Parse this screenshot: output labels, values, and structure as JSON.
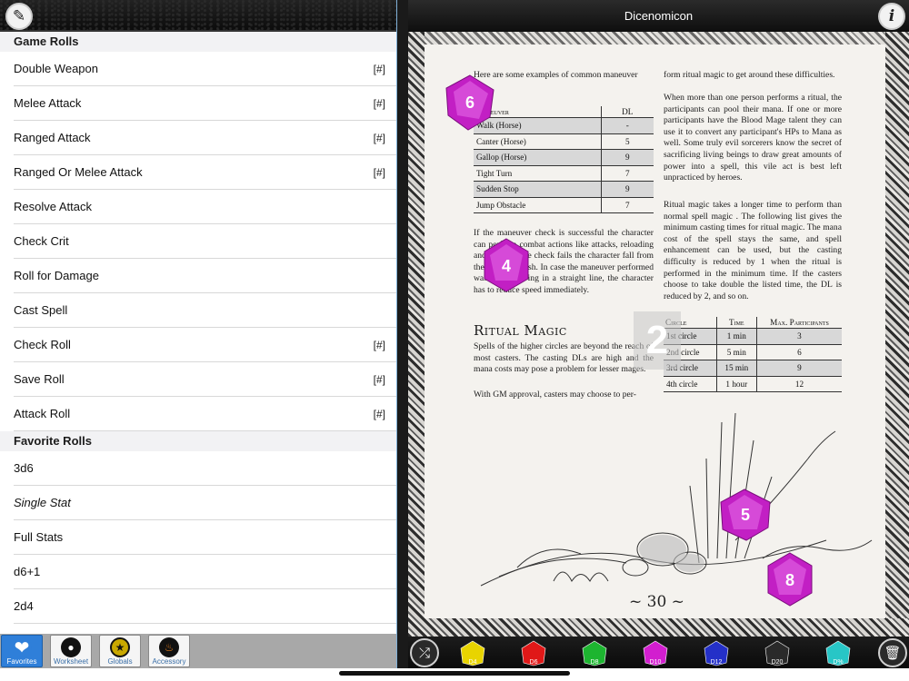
{
  "left": {
    "sections": [
      {
        "title": "Game Rolls",
        "rows": [
          {
            "label": "Double Weapon",
            "tag": "[#]"
          },
          {
            "label": "Melee Attack",
            "tag": "[#]"
          },
          {
            "label": "Ranged Attack",
            "tag": "[#]"
          },
          {
            "label": "Ranged Or Melee Attack",
            "tag": "[#]"
          },
          {
            "label": "Resolve Attack",
            "tag": ""
          },
          {
            "label": "Check Crit",
            "tag": ""
          },
          {
            "label": "Roll for Damage",
            "tag": ""
          },
          {
            "label": "Cast Spell",
            "tag": ""
          },
          {
            "label": "Check Roll",
            "tag": "[#]"
          },
          {
            "label": "Save Roll",
            "tag": "[#]"
          },
          {
            "label": "Attack Roll",
            "tag": "[#]"
          }
        ]
      },
      {
        "title": "Favorite Rolls",
        "rows": [
          {
            "label": "3d6",
            "tag": ""
          },
          {
            "label": "Single Stat",
            "tag": ""
          },
          {
            "label": "Full Stats",
            "tag": ""
          },
          {
            "label": "d6+1",
            "tag": ""
          },
          {
            "label": "2d4",
            "tag": ""
          }
        ]
      }
    ],
    "tabs": [
      {
        "label": "Favorites",
        "icon": "heart-icon"
      },
      {
        "label": "Worksheet",
        "icon": "person-icon"
      },
      {
        "label": "Globals",
        "icon": "star-icon"
      },
      {
        "label": "Accessory",
        "icon": "cauldron-icon"
      }
    ]
  },
  "right": {
    "title": "Dicenomicon",
    "page": {
      "intro": "Here are some examples of common maneuver",
      "maneuver_table": {
        "headers": [
          "Maneuver",
          "DL"
        ],
        "rows": [
          [
            "Walk (Horse)",
            "-"
          ],
          [
            "Canter (Horse)",
            "5"
          ],
          [
            "Gallop (Horse)",
            "9"
          ],
          [
            "Tight Turn",
            "7"
          ],
          [
            "Sudden Stop",
            "9"
          ],
          [
            "Jump Obstacle",
            "7"
          ]
        ]
      },
      "para1": "If the maneuver check is successful the character can perform combat actions like attacks, reloading and so on. If the check fails the character fall from the horse or crash. In case the maneuver performed was riding/driving in a straight line, the character has to reduce speed immediately.",
      "heading": "Ritual Magic",
      "para2": "Spells of the higher circles are beyond the reach of most casters. The casting DLs are high and the mana costs may pose a problem for lesser mages.",
      "para3": "With GM approval, casters may choose to per-",
      "right_para0": "form ritual magic to get around these difficulties.",
      "right_para1": "When more than one person performs a ritual, the participants can pool their mana. If one or more participants have the Blood Mage talent they can use it to convert any participant's HPs to Mana as well. Some truly evil sorcerers know the secret of sacrificing living beings to draw great amounts of power into a spell, this vile act is best left unpracticed by heroes.",
      "right_para2": "Ritual magic takes a longer time to perform than normal spell magic . The following list gives the minimum casting times for ritual magic. The mana cost of the spell stays the same, and spell enhancement can be used, but the casting difficulty is reduced by 1 when the ritual is performed in the minimum time. If the casters choose to take double the listed time, the DL is reduced by 2, and so on.",
      "circle_table": {
        "headers": [
          "Circle",
          "Time",
          "Max. Participants"
        ],
        "rows": [
          [
            "1st circle",
            "1 min",
            "3"
          ],
          [
            "2nd circle",
            "5 min",
            "6"
          ],
          [
            "3rd circle",
            "15 min",
            "9"
          ],
          [
            "4th circle",
            "1 hour",
            "12"
          ]
        ]
      },
      "page_number": "~ 30 ~",
      "overlay_number": "2"
    },
    "dice_faces": [
      "6",
      "4",
      "5",
      "8"
    ],
    "dice_buttons": [
      {
        "label": "D4",
        "color": "#e8d400"
      },
      {
        "label": "D6",
        "color": "#e01818"
      },
      {
        "label": "D8",
        "color": "#1db530"
      },
      {
        "label": "D10",
        "color": "#d21ecf"
      },
      {
        "label": "D12",
        "color": "#2430c8"
      },
      {
        "label": "D20",
        "color": "#2a2a2a"
      },
      {
        "label": "D%",
        "color": "#28c6c6"
      }
    ]
  }
}
